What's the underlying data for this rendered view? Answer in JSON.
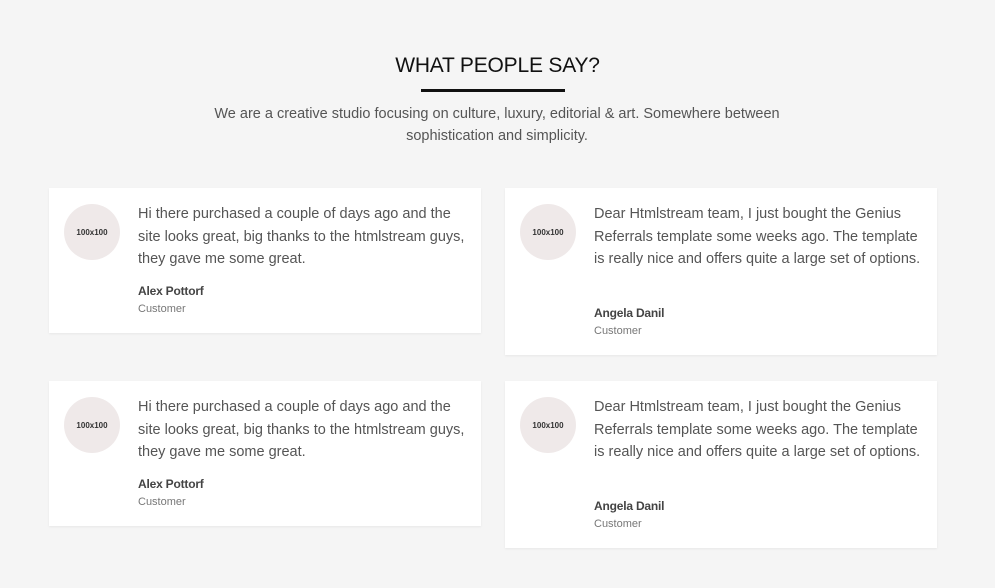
{
  "section": {
    "title": "WHAT PEOPLE SAY?",
    "subtitle": "We are a creative studio focusing on culture, luxury, editorial & art. Somewhere between sophistication and simplicity."
  },
  "testimonials": [
    {
      "avatar": "100x100",
      "quote": "Hi there purchased a couple of days ago and the site looks great, big thanks to the htmlstream guys, they gave me some great.",
      "name": "Alex Pottorf",
      "role": "Customer"
    },
    {
      "avatar": "100x100",
      "quote": "Dear Htmlstream team, I just bought the Genius Referrals template some weeks ago. The template is really nice and offers quite a large set of options.",
      "name": "Angela Danil",
      "role": "Customer"
    },
    {
      "avatar": "100x100",
      "quote": "Hi there purchased a couple of days ago and the site looks great, big thanks to the htmlstream guys, they gave me some great.",
      "name": "Alex Pottorf",
      "role": "Customer"
    },
    {
      "avatar": "100x100",
      "quote": "Dear Htmlstream team, I just bought the Genius Referrals template some weeks ago. The template is really nice and offers quite a large set of options.",
      "name": "Angela Danil",
      "role": "Customer"
    }
  ]
}
